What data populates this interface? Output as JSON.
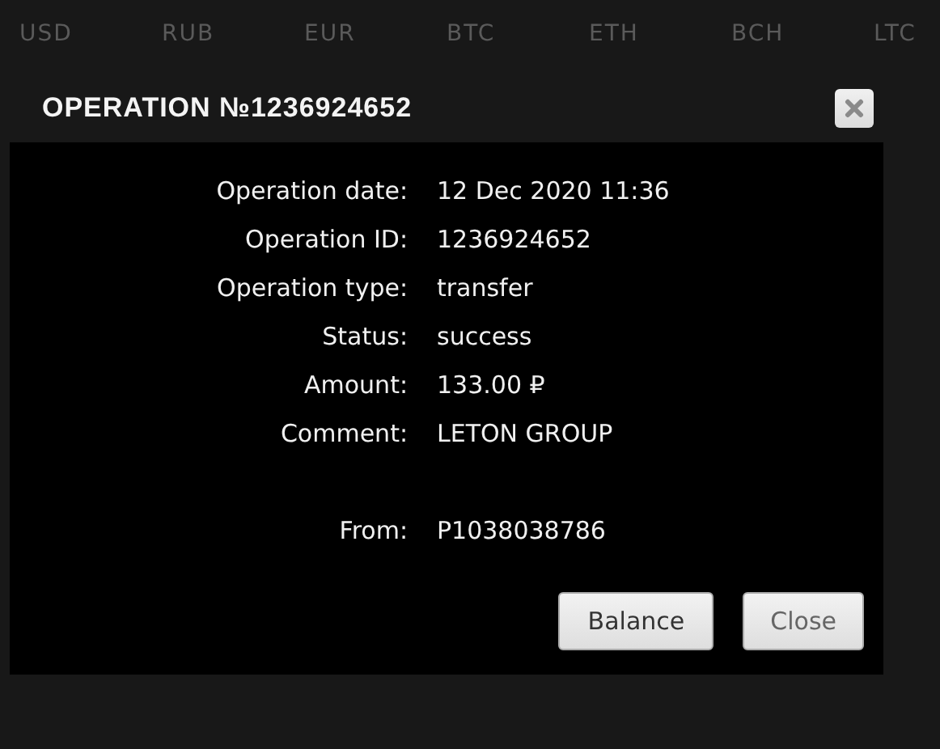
{
  "currency_tabs": [
    "USD",
    "RUB",
    "EUR",
    "BTC",
    "ETH",
    "BCH",
    "LTC"
  ],
  "dialog": {
    "title": "OPERATION №1236924652",
    "details": [
      {
        "label": "Operation date:",
        "value": "12 Dec 2020 11:36"
      },
      {
        "label": "Operation ID:",
        "value": "1236924652"
      },
      {
        "label": "Operation type:",
        "value": "transfer"
      },
      {
        "label": "Status:",
        "value": "success"
      },
      {
        "label": "Amount:",
        "value": "133.00 ₽"
      },
      {
        "label": "Comment:",
        "value": "LETON GROUP"
      }
    ],
    "sender": [
      {
        "label": "From:",
        "value": "P1038038786"
      }
    ],
    "buttons": [
      "Balance",
      "Close"
    ]
  }
}
